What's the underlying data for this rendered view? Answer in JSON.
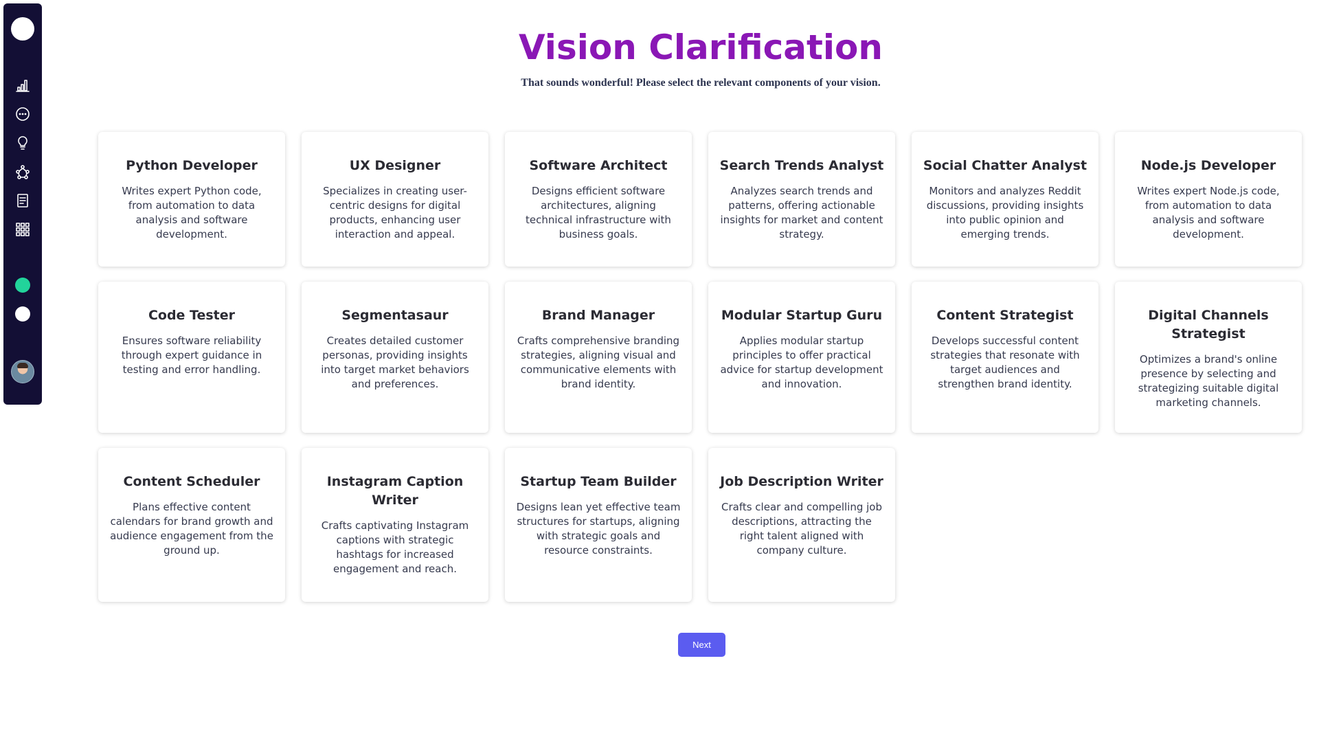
{
  "header": {
    "title": "Vision Clarification",
    "subtitle": "That sounds wonderful! Please select the relevant components of your vision."
  },
  "sidebar": {
    "icons": [
      "bar-chart-icon",
      "chat-bubble-icon",
      "lightbulb-icon",
      "network-icon",
      "document-list-icon",
      "grid-apps-icon"
    ],
    "status_colors": {
      "online": "#22d49b",
      "idle": "#ffffff"
    }
  },
  "cards": [
    {
      "title": "Python Developer",
      "description": "Writes expert Python code, from automation to data analysis and software development."
    },
    {
      "title": "UX Designer",
      "description": "Specializes in creating user-centric designs for digital products, enhancing user interaction and appeal."
    },
    {
      "title": "Software Architect",
      "description": "Designs efficient software architectures, aligning technical infrastructure with business goals."
    },
    {
      "title": "Search Trends Analyst",
      "description": "Analyzes search trends and patterns, offering actionable insights for market and content strategy."
    },
    {
      "title": "Social Chatter Analyst",
      "description": "Monitors and analyzes Reddit discussions, providing insights into public opinion and emerging trends."
    },
    {
      "title": "Node.js Developer",
      "description": "Writes expert Node.js code, from automation to data analysis and software development."
    },
    {
      "title": "Code Tester",
      "description": "Ensures software reliability through expert guidance in testing and error handling."
    },
    {
      "title": "Segmentasaur",
      "description": "Creates detailed customer personas, providing insights into target market behaviors and preferences."
    },
    {
      "title": "Brand Manager",
      "description": "Crafts comprehensive branding strategies, aligning visual and communicative elements with brand identity."
    },
    {
      "title": "Modular Startup Guru",
      "description": "Applies modular startup principles to offer practical advice for startup development and innovation."
    },
    {
      "title": "Content Strategist",
      "description": "Develops successful content strategies that resonate with target audiences and strengthen brand identity."
    },
    {
      "title": "Digital Channels Strategist",
      "description": "Optimizes a brand's online presence by selecting and strategizing suitable digital marketing channels."
    },
    {
      "title": "Content Scheduler",
      "description": "Plans effective content calendars for brand growth and audience engagement from the ground up."
    },
    {
      "title": "Instagram Caption Writer",
      "description": "Crafts captivating Instagram captions with strategic hashtags for increased engagement and reach."
    },
    {
      "title": "Startup Team Builder",
      "description": "Designs lean yet effective team structures for startups, aligning with strategic goals and resource constraints."
    },
    {
      "title": "Job Description Writer",
      "description": "Crafts clear and compelling job descriptions, attracting the right talent aligned with company culture."
    }
  ],
  "actions": {
    "next_label": "Next"
  }
}
